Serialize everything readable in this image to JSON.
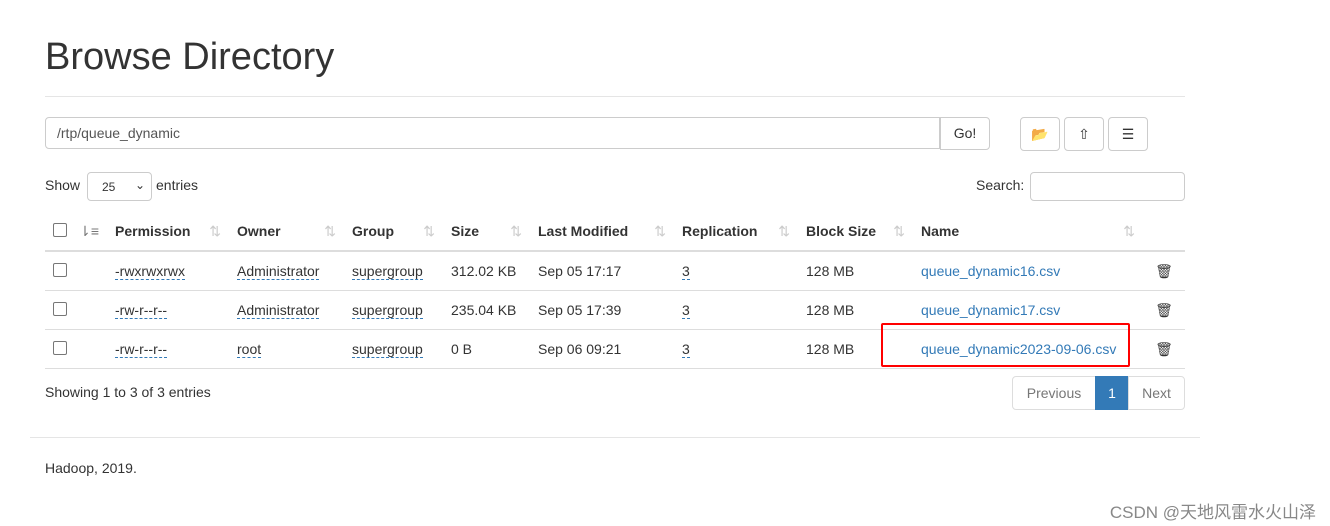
{
  "title": "Browse Directory",
  "path": "/rtp/queue_dynamic",
  "go": "Go!",
  "icons": [
    "folder-open-icon",
    "upload-icon",
    "list-icon"
  ],
  "show": "Show",
  "page_size": "25",
  "entries": "entries",
  "search_label": "Search:",
  "columns": [
    "Permission",
    "Owner",
    "Group",
    "Size",
    "Last Modified",
    "Replication",
    "Block Size",
    "Name"
  ],
  "rows": [
    {
      "perm": "-rwxrwxrwx",
      "owner": "Administrator",
      "group": "supergroup",
      "size": "312.02 KB",
      "modified": "Sep 05 17:17",
      "repl": "3",
      "block": "128 MB",
      "name": "queue_dynamic16.csv"
    },
    {
      "perm": "-rw-r--r--",
      "owner": "Administrator",
      "group": "supergroup",
      "size": "235.04 KB",
      "modified": "Sep 05 17:39",
      "repl": "3",
      "block": "128 MB",
      "name": "queue_dynamic17.csv"
    },
    {
      "perm": "-rw-r--r--",
      "owner": "root",
      "group": "supergroup",
      "size": "0 B",
      "modified": "Sep 06 09:21",
      "repl": "3",
      "block": "128 MB",
      "name": "queue_dynamic2023-09-06.csv"
    }
  ],
  "info": "Showing 1 to 3 of 3 entries",
  "pagination": {
    "prev": "Previous",
    "current": "1",
    "next": "Next"
  },
  "footer": "Hadoop, 2019.",
  "watermark": "CSDN @天地风雷水火山泽",
  "highlight_color": "#ff0000"
}
